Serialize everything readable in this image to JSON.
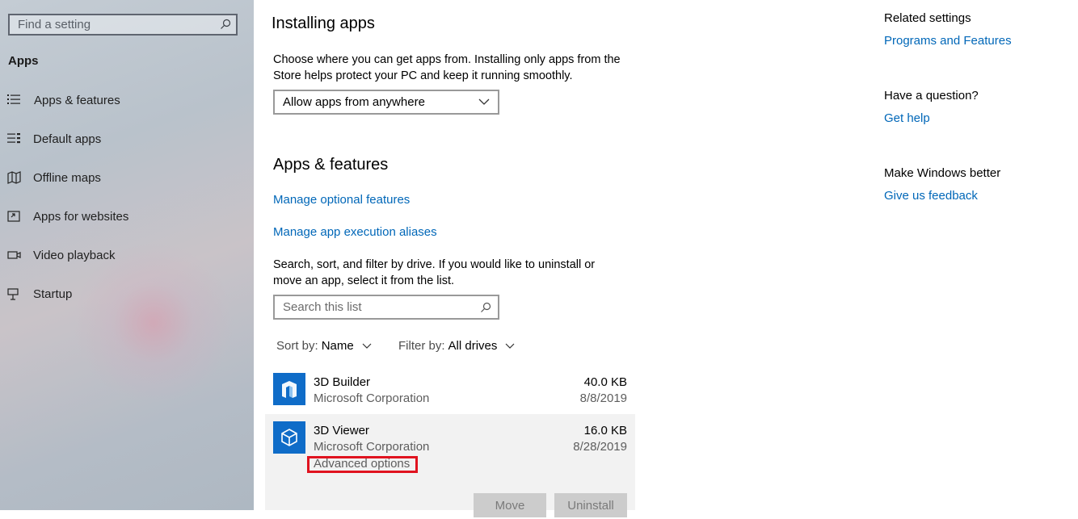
{
  "sidebar": {
    "search_placeholder": "Find a setting",
    "section_title": "Apps",
    "items": [
      {
        "label": "Apps & features",
        "icon": "list-icon"
      },
      {
        "label": "Default apps",
        "icon": "default-apps-icon"
      },
      {
        "label": "Offline maps",
        "icon": "map-icon"
      },
      {
        "label": "Apps for websites",
        "icon": "open-in-app-icon"
      },
      {
        "label": "Video playback",
        "icon": "video-icon"
      },
      {
        "label": "Startup",
        "icon": "startup-icon"
      }
    ]
  },
  "installing": {
    "title": "Installing apps",
    "desc_line1": "Choose where you can get apps from. Installing only apps from the",
    "desc_line2": "Store helps protect your PC and keep it running smoothly.",
    "dropdown_value": "Allow apps from anywhere"
  },
  "apps_features": {
    "title": "Apps & features",
    "link_optional": "Manage optional features",
    "link_aliases": "Manage app execution aliases",
    "desc_line1": "Search, sort, and filter by drive. If you would like to uninstall or",
    "desc_line2": "move an app, select it from the list.",
    "search_placeholder": "Search this list",
    "sort_label": "Sort by:",
    "sort_value": "Name",
    "filter_label": "Filter by:",
    "filter_value": "All drives"
  },
  "apps": [
    {
      "name": "3D Builder",
      "publisher": "Microsoft Corporation",
      "size": "40.0 KB",
      "date": "8/8/2019",
      "icon": "3d-builder-icon"
    },
    {
      "name": "3D Viewer",
      "publisher": "Microsoft Corporation",
      "size": "16.0 KB",
      "date": "8/28/2019",
      "icon": "3d-viewer-icon",
      "advanced": "Advanced options",
      "move": "Move",
      "uninstall": "Uninstall"
    }
  ],
  "right": {
    "related_title": "Related settings",
    "related_link": "Programs and Features",
    "question_title": "Have a question?",
    "question_link": "Get help",
    "better_title": "Make Windows better",
    "better_link": "Give us feedback"
  },
  "colors": {
    "accent": "#0067b8",
    "tile": "#0f6cc8",
    "highlight": "#e0131f"
  }
}
